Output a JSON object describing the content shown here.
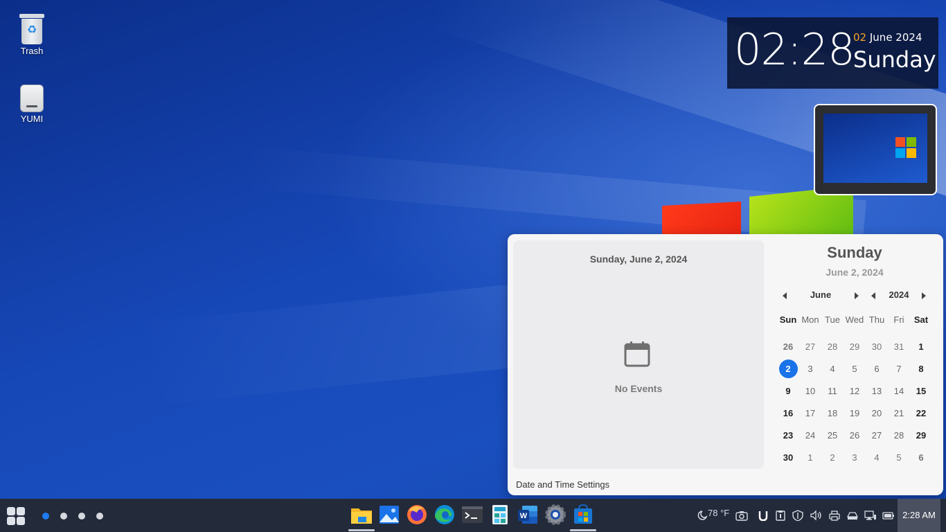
{
  "desktop": {
    "icons": [
      {
        "label": "Trash"
      },
      {
        "label": "YUMI"
      }
    ]
  },
  "clock_widget": {
    "time": "02:28",
    "day_number": "02",
    "month_year": "June 2024",
    "weekday": "Sunday"
  },
  "calendar_popup": {
    "events_title": "Sunday, June 2, 2024",
    "no_events_label": "No Events",
    "settings_link": "Date and Time Settings",
    "weekday_big": "Sunday",
    "date_sub": "June 2, 2024",
    "month_label": "June",
    "year_label": "2024",
    "day_headers": [
      "Sun",
      "Mon",
      "Tue",
      "Wed",
      "Thu",
      "Fri",
      "Sat"
    ],
    "weeks": [
      [
        "26",
        "27",
        "28",
        "29",
        "30",
        "31",
        "1"
      ],
      [
        "2",
        "3",
        "4",
        "5",
        "6",
        "7",
        "8"
      ],
      [
        "9",
        "10",
        "11",
        "12",
        "13",
        "14",
        "15"
      ],
      [
        "16",
        "17",
        "18",
        "19",
        "20",
        "21",
        "22"
      ],
      [
        "23",
        "24",
        "25",
        "26",
        "27",
        "28",
        "29"
      ],
      [
        "30",
        "1",
        "2",
        "3",
        "4",
        "5",
        "6"
      ]
    ],
    "today": "2",
    "accent_color": "#1a73e8"
  },
  "taskbar": {
    "workspaces": 4,
    "active_workspace": 1,
    "apps": [
      {
        "name": "file-manager-icon"
      },
      {
        "name": "image-viewer-icon"
      },
      {
        "name": "firefox-icon"
      },
      {
        "name": "edge-icon"
      },
      {
        "name": "terminal-icon"
      },
      {
        "name": "calculator-icon"
      },
      {
        "name": "word-icon"
      },
      {
        "name": "settings-icon"
      },
      {
        "name": "store-icon"
      }
    ],
    "weather": "78 °F",
    "clock": "2:28 AM"
  }
}
